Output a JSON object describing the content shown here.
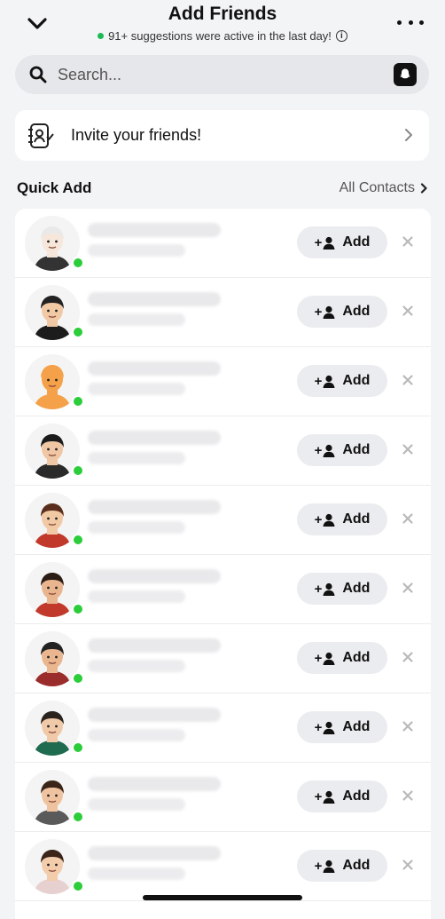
{
  "header": {
    "title": "Add Friends",
    "subtitle": "91+ suggestions were active in the last day!",
    "info_symbol": "i",
    "back_icon": "chevron-down-icon",
    "more_icon": "more-horizontal-icon"
  },
  "search": {
    "placeholder": "Search...",
    "value": ""
  },
  "invite": {
    "label": "Invite your friends!"
  },
  "section": {
    "title": "Quick Add",
    "all_contacts": "All Contacts"
  },
  "add_label": "Add",
  "add_prefix": "+",
  "colors": {
    "online": "#2ccd3a",
    "button_bg": "#ebecef",
    "background": "#f3f4f6"
  },
  "suggestions": [
    {
      "avatar": "bitmoji-halo-woman"
    },
    {
      "avatar": "bitmoji-man"
    },
    {
      "avatar": "default-silhouette"
    },
    {
      "avatar": "bitmoji-woman-dark-hair"
    },
    {
      "avatar": "bitmoji-woman-brown-hair"
    },
    {
      "avatar": "bitmoji-halo-man"
    },
    {
      "avatar": "bitmoji-man"
    },
    {
      "avatar": "bitmoji-man-beard"
    },
    {
      "avatar": "bitmoji-woman"
    },
    {
      "avatar": "bitmoji-bunny-ears-woman"
    }
  ]
}
